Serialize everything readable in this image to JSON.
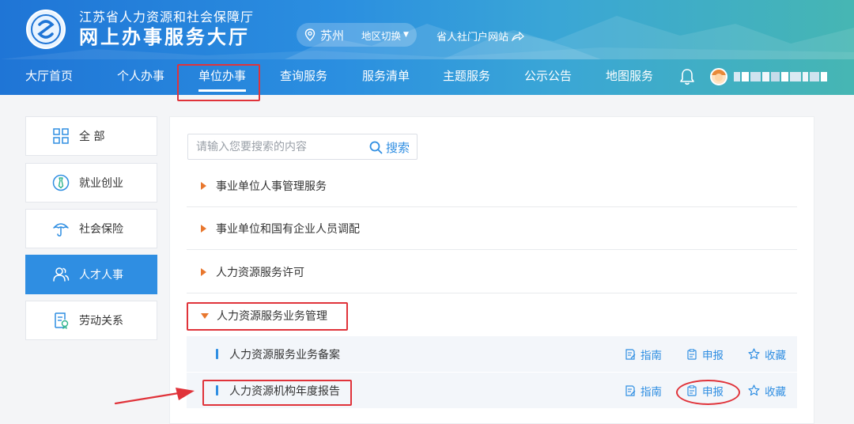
{
  "header": {
    "title_line1": "江苏省人力资源和社会保障厅",
    "title_line2": "网上办事服务大厅",
    "city": "苏州",
    "region_switch": "地区切换",
    "portal_link": "省人社门户网站"
  },
  "nav": {
    "items": [
      "大厅首页",
      "个人办事",
      "单位办事",
      "查询服务",
      "服务清单",
      "主题服务",
      "公示公告",
      "地图服务"
    ],
    "active_index": 2
  },
  "sidebar": {
    "items": [
      {
        "label": "全 部",
        "icon": "grid-icon"
      },
      {
        "label": "就业创业",
        "icon": "tie-icon"
      },
      {
        "label": "社会保险",
        "icon": "umbrella-icon"
      },
      {
        "label": "人才人事",
        "icon": "people-icon"
      },
      {
        "label": "劳动关系",
        "icon": "contract-icon"
      }
    ],
    "active_index": 3
  },
  "search": {
    "placeholder": "请输入您要搜索的内容",
    "button_label": "搜索"
  },
  "categories": [
    {
      "label": "事业单位人事管理服务",
      "expanded": false
    },
    {
      "label": "事业单位和国有企业人员调配",
      "expanded": false
    },
    {
      "label": "人力资源服务许可",
      "expanded": false
    },
    {
      "label": "人力资源服务业务管理",
      "expanded": true
    }
  ],
  "sub_items": [
    {
      "label": "人力资源服务业务备案"
    },
    {
      "label": "人力资源机构年度报告"
    }
  ],
  "actions": {
    "guide": "指南",
    "apply": "申报",
    "favorite": "收藏"
  },
  "colors": {
    "primary": "#2f8ee2",
    "accent_orange": "#e8772e",
    "annotation_red": "#e0333a"
  }
}
